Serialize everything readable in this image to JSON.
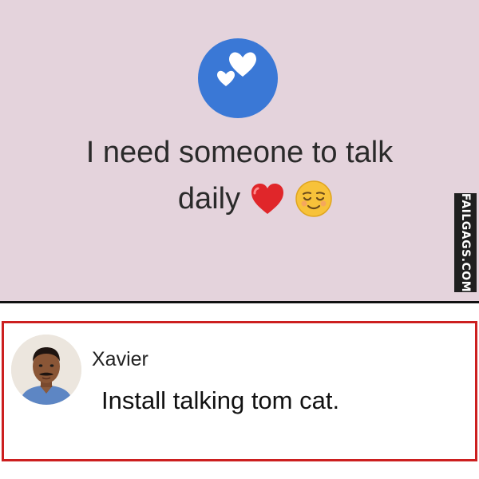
{
  "post": {
    "icon": "two-hearts-icon",
    "line1": "I need someone to talk",
    "line2_word": "daily",
    "emojis": [
      "red-heart-emoji",
      "relieved-face-emoji"
    ],
    "background_color": "#e4d3dc",
    "icon_color": "#3a78d6"
  },
  "watermark": {
    "text": "FAILGAGS.COM"
  },
  "comment": {
    "author": "Xavier",
    "text": "Install talking tom cat.",
    "border_color": "#cc1f1f"
  }
}
